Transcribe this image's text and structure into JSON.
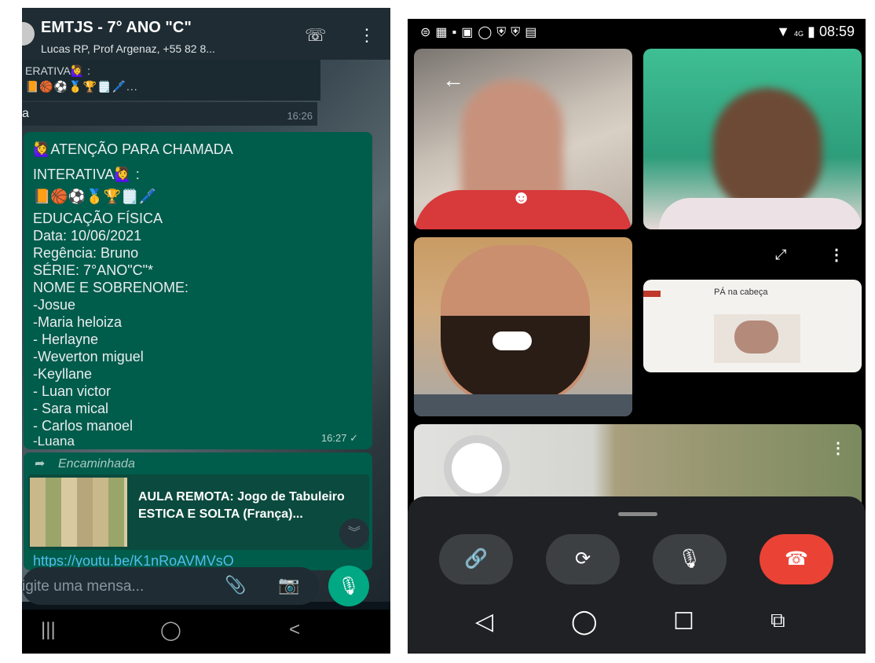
{
  "whatsapp": {
    "header": {
      "title": "EMTJS - 7° ANO \"C\"",
      "subtitle": "Lucas RP, Prof Argenaz, +55 82 8...",
      "icons": [
        "add-call-icon",
        "more-vert-icon"
      ]
    },
    "quoted_preview": {
      "line1": "ERATIVA🙋‍♀️ :",
      "line2": "📙🏀⚽🥇🏆🗒️🖊️..."
    },
    "prev_message": {
      "text": "a",
      "time": "16:26"
    },
    "message": {
      "lines": [
        "🙋‍♀️ATENÇÃO PARA CHAMADA",
        "INTERATIVA🙋‍♀️ :",
        "📙🏀⚽🥇🏆🗒️🖊️",
        "EDUCAÇÃO FÍSICA",
        "Data: 10/06/2021",
        "Regência: Bruno",
        "SÉRIE:  7°ANO\"C\"*",
        "NOME E SOBRENOME:",
        "-Josue",
        "-Maria heloiza",
        "- Herlayne",
        "-Weverton miguel",
        "-Keyllane",
        "- Luan victor",
        "- Sara mical",
        "- Carlos manoel",
        "-Luana"
      ],
      "time": "16:27 ✓"
    },
    "forwarded": {
      "label": "Encaminhada",
      "title": "AULA REMOTA: Jogo de Tabuleiro ESTICA E SOLTA (França)...",
      "link": "https://youtu.be/K1nRoAVMVsO"
    },
    "input": {
      "placeholder": "igite uma mensa..."
    },
    "nav": [
      "|||",
      "◯",
      "<"
    ]
  },
  "call": {
    "status_bar": {
      "left_icons": "⊜▦▪▣◯⛨⛨▤",
      "time": "08:59",
      "network": "4G"
    },
    "slide": {
      "title": "PÁ na cabeça"
    },
    "controls": {
      "buttons": [
        "link-icon",
        "flip-camera-icon",
        "mic-icon",
        "hang-up-icon"
      ]
    },
    "nav": [
      "◁",
      "◯",
      "☐",
      "⧉"
    ]
  },
  "colors": {
    "whatsapp_bubble": "#005c4b",
    "whatsapp_header": "#1f2c34",
    "hangup_red": "#ea4335",
    "call_controls_bg": "#202124"
  }
}
